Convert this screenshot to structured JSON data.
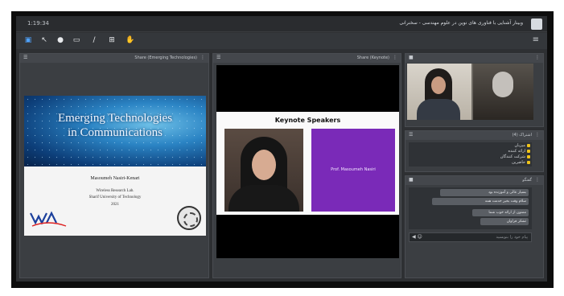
{
  "window": {
    "time": "1:19:34",
    "title": "وبینار آشنایی با فناوری های نوین در علوم مهندسی - سخنرانی"
  },
  "toolbar": {
    "icons": [
      "share-icon",
      "pointer-icon",
      "chat-icon",
      "screen-icon",
      "pen-icon",
      "grid-icon",
      "hand-icon"
    ],
    "menu_icon": "menu-icon"
  },
  "share_pod_1": {
    "title": "Share (Emerging Technologies)",
    "slide": {
      "title_line1": "Emerging Technologies",
      "title_line2": "in Communications",
      "presenter": "Masoumeh Nasiri-Kenari",
      "line1": "Wireless Research Lab.",
      "line2": "Sharif University of Technology",
      "year": "2021"
    }
  },
  "share_pod_2": {
    "title": "Share (Keynote)",
    "slide": {
      "title": "Keynote Speakers",
      "speaker_name": "Prof. Masoumeh Nasiri"
    }
  },
  "camera_pod": {
    "title": ""
  },
  "attendees_pod": {
    "title": "اشتراک (4)",
    "items": [
      "میزبان",
      "ارائه کننده",
      "شرکت کنندگان",
      "حاضرین"
    ]
  },
  "chat_pod": {
    "title": "گفتگو",
    "messages": [
      "بسیار عالی و آموزنده بود",
      "سلام وقت بخیر خدمت همه",
      "ممنون از ارائه خوب شما",
      "تشکر فراوان"
    ],
    "placeholder": "پیام خود را بنویسید"
  },
  "colors": {
    "app_bg": "#2e3033",
    "accent_blue": "#4fa3ff",
    "speaker_card": "#7a2ab8",
    "status_yellow": "#f0c419"
  }
}
